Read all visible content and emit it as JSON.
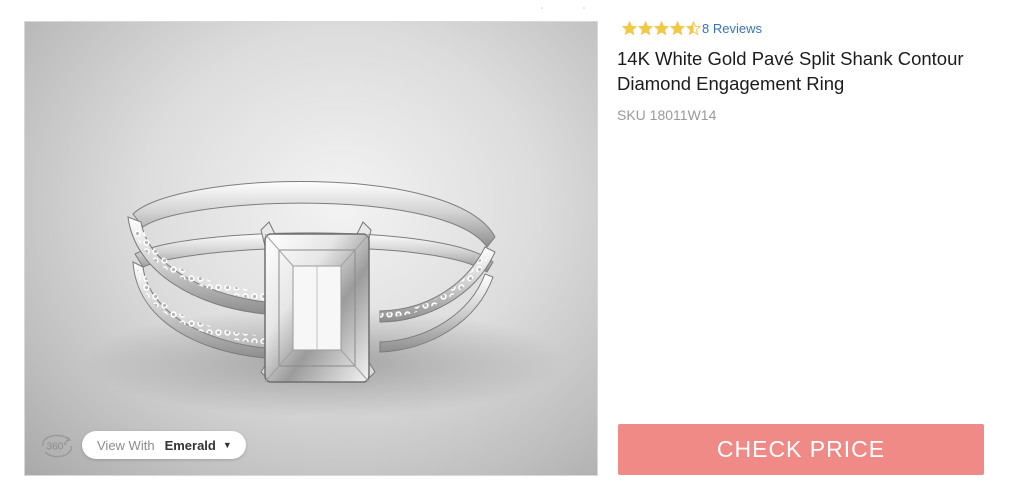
{
  "gallery": {
    "view_with_label": "View With",
    "view_with_value": "Emerald",
    "spin_label": "360°"
  },
  "rating": {
    "stars": 4.5,
    "max": 5,
    "reviews_text": "8 Reviews",
    "star_color": "#f2c84b"
  },
  "product": {
    "title": "14K White Gold Pavé Split Shank Contour Diamond Engagement Ring",
    "sku": "SKU 18011W14"
  },
  "cta": {
    "label": "CHECK PRICE",
    "color": "#ef8a87"
  }
}
